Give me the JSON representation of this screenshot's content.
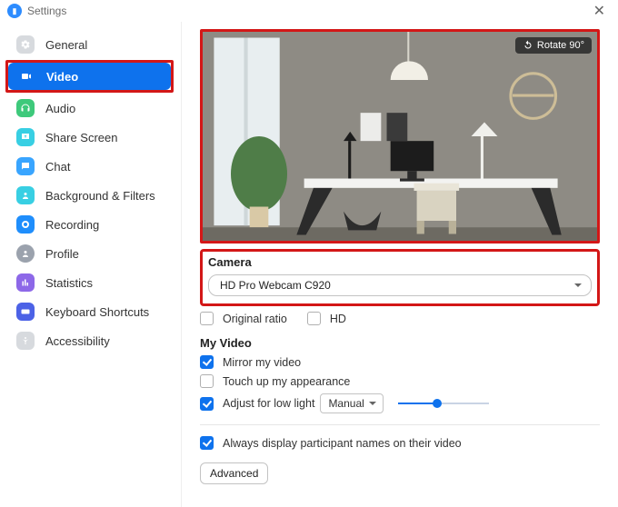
{
  "titlebar": {
    "title": "Settings"
  },
  "sidebar": {
    "items": [
      {
        "label": "General"
      },
      {
        "label": "Video"
      },
      {
        "label": "Audio"
      },
      {
        "label": "Share Screen"
      },
      {
        "label": "Chat"
      },
      {
        "label": "Background & Filters"
      },
      {
        "label": "Recording"
      },
      {
        "label": "Profile"
      },
      {
        "label": "Statistics"
      },
      {
        "label": "Keyboard Shortcuts"
      },
      {
        "label": "Accessibility"
      }
    ]
  },
  "preview": {
    "rotate_label": "Rotate 90°"
  },
  "camera": {
    "section_title": "Camera",
    "selected": "HD Pro Webcam C920",
    "original_ratio": "Original ratio",
    "hd": "HD"
  },
  "my_video": {
    "section_title": "My Video",
    "mirror": "Mirror my video",
    "touch_up": "Touch up my appearance",
    "low_light": "Adjust for low light",
    "low_light_mode": "Manual"
  },
  "participants": {
    "always_names": "Always display participant names on their video"
  },
  "advanced": {
    "label": "Advanced"
  }
}
